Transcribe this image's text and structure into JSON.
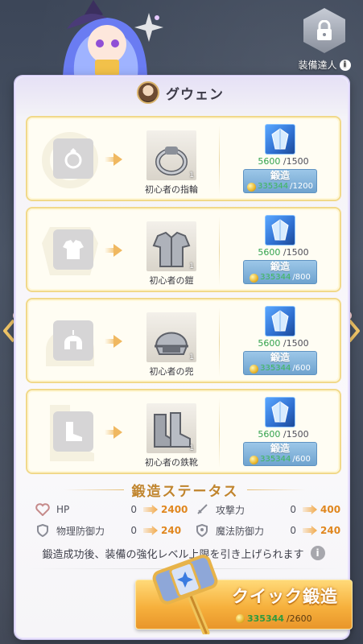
{
  "header": {
    "master_label": "装備達人",
    "info_glyph": "i"
  },
  "character": {
    "name": "グウェン"
  },
  "gear": [
    {
      "slot": "ring",
      "item_name": "初心者の指輪",
      "item_count": "1",
      "crystal_have": "5600",
      "crystal_need": "/1500",
      "forge_label": "鍛造",
      "gold_have": "335344",
      "gold_need": "/1200"
    },
    {
      "slot": "armor",
      "item_name": "初心者の鎧",
      "item_count": "1",
      "crystal_have": "5600",
      "crystal_need": "/1500",
      "forge_label": "鍛造",
      "gold_have": "335344",
      "gold_need": "/800"
    },
    {
      "slot": "helmet",
      "item_name": "初心者の兜",
      "item_count": "1",
      "crystal_have": "5600",
      "crystal_need": "/1500",
      "forge_label": "鍛造",
      "gold_have": "335344",
      "gold_need": "/600"
    },
    {
      "slot": "boots",
      "item_name": "初心者の鉄靴",
      "item_count": "1",
      "crystal_have": "5600",
      "crystal_need": "/1500",
      "forge_label": "鍛造",
      "gold_have": "335344",
      "gold_need": "/600"
    }
  ],
  "stats": {
    "title": "鍛造ステータス",
    "items": [
      {
        "name": "HP",
        "from": "0",
        "to": "2400",
        "icon": "heart-icon"
      },
      {
        "name": "攻撃力",
        "from": "0",
        "to": "400",
        "icon": "sword-icon"
      },
      {
        "name": "物理防御力",
        "from": "0",
        "to": "240",
        "icon": "shield-icon"
      },
      {
        "name": "魔法防御力",
        "from": "0",
        "to": "240",
        "icon": "magic-shield-icon"
      }
    ]
  },
  "note": "鍛造成功後、装備の強化レベル上限を引き上げられます",
  "quick_forge": {
    "label": "クイック鍛造",
    "gold_have": "335344",
    "gold_need": "/2600"
  },
  "colors": {
    "accent_gold": "#f6b13d",
    "forge_blue": "#6fa3cf",
    "have_green": "#31a24c",
    "stat_orange": "#e0871f"
  }
}
